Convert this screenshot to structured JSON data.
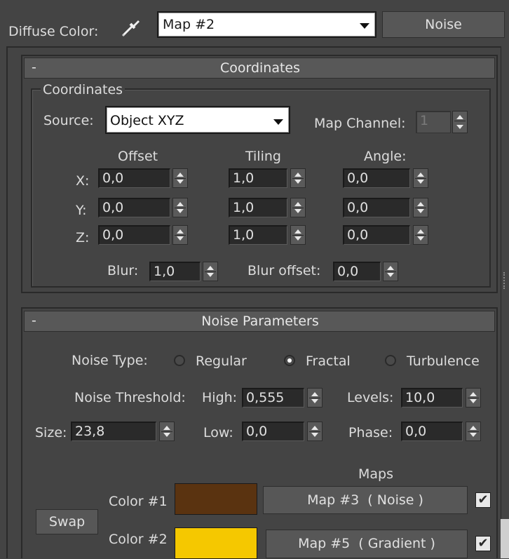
{
  "header": {
    "diffuse_label": "Diffuse Color:",
    "map_selected": "Map #2",
    "type_button": "Noise"
  },
  "coordinates": {
    "rollout_title": "Coordinates",
    "collapse_symbol": "-",
    "group_title": "Coordinates",
    "source_label": "Source:",
    "source_value": "Object XYZ",
    "map_channel_label": "Map Channel:",
    "map_channel_value": "1",
    "col_offset": "Offset",
    "col_tiling": "Tiling",
    "col_angle": "Angle:",
    "rows": [
      {
        "axis": "X:",
        "offset": "0,0",
        "tiling": "1,0",
        "angle": "0,0"
      },
      {
        "axis": "Y:",
        "offset": "0,0",
        "tiling": "1,0",
        "angle": "0,0"
      },
      {
        "axis": "Z:",
        "offset": "0,0",
        "tiling": "1,0",
        "angle": "0,0"
      }
    ],
    "blur_label": "Blur:",
    "blur_value": "1,0",
    "blur_offset_label": "Blur offset:",
    "blur_offset_value": "0,0"
  },
  "noise": {
    "rollout_title": "Noise Parameters",
    "collapse_symbol": "-",
    "noise_type_label": "Noise Type:",
    "types": [
      "Regular",
      "Fractal",
      "Turbulence"
    ],
    "selected_type": "Fractal",
    "threshold_label": "Noise Threshold:",
    "high_label": "High:",
    "high_value": "0,555",
    "levels_label": "Levels:",
    "levels_value": "10,0",
    "size_label": "Size:",
    "size_value": "23,8",
    "low_label": "Low:",
    "low_value": "0,0",
    "phase_label": "Phase:",
    "phase_value": "0,0",
    "maps_label": "Maps",
    "swap_label": "Swap",
    "color1_label": "Color #1",
    "color1_hex": "#5a3310",
    "color1_map": "Map #3  ( Noise )",
    "color1_checked": true,
    "color2_label": "Color #2",
    "color2_hex": "#f5c800",
    "color2_map": "Map #5  ( Gradient )",
    "color2_checked": true
  }
}
